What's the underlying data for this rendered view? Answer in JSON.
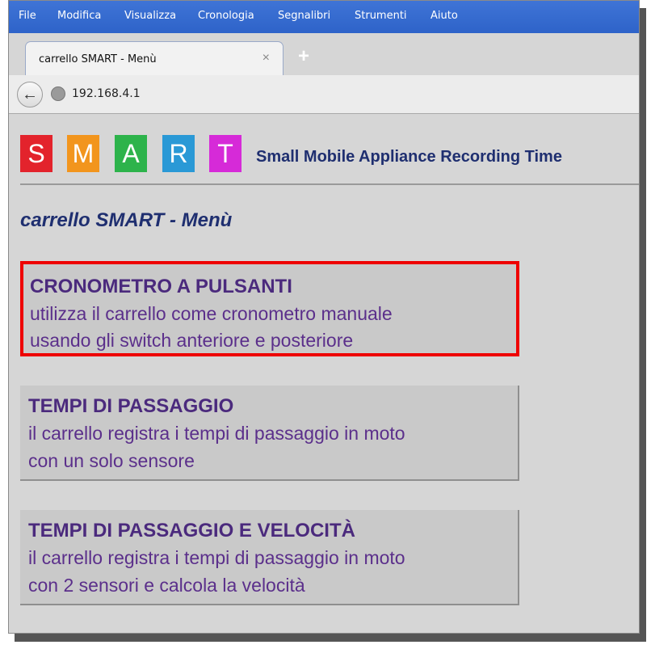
{
  "menubar": {
    "items": [
      "File",
      "Modifica",
      "Visualizza",
      "Cronologia",
      "Segnalibri",
      "Strumenti",
      "Aiuto"
    ]
  },
  "tab": {
    "title": "carrello SMART - Menù",
    "close": "×",
    "new_tab": "+"
  },
  "nav": {
    "back": "←",
    "url": "192.168.4.1"
  },
  "logo": {
    "letters": [
      "S",
      "M",
      "A",
      "R",
      "T"
    ],
    "colors": [
      "#e3232c",
      "#f2951d",
      "#2db34b",
      "#2a99d6",
      "#d62ad8"
    ],
    "tagline": "Small Mobile Appliance Recording Time"
  },
  "page": {
    "heading": "carrello SMART - Menù",
    "cards": [
      {
        "title": "CRONOMETRO A PULSANTI",
        "line1": "utilizza il carrello come cronometro manuale",
        "line2": "usando gli switch anteriore e posteriore",
        "selected": true
      },
      {
        "title": "TEMPI DI PASSAGGIO",
        "line1": "il carrello registra i tempi di passaggio in moto",
        "line2": "con un solo sensore",
        "selected": false
      },
      {
        "title": "TEMPI DI PASSAGGIO E VELOCITÀ",
        "line1": "il carrello registra i tempi di passaggio in moto",
        "line2": "con 2 sensori e calcola la velocità",
        "selected": false
      }
    ]
  },
  "colors": {
    "accent_blue": "#2e63c9",
    "selection_border": "#ee0000",
    "heading": "#1f2f70",
    "card_text": "#5b2f8b"
  }
}
